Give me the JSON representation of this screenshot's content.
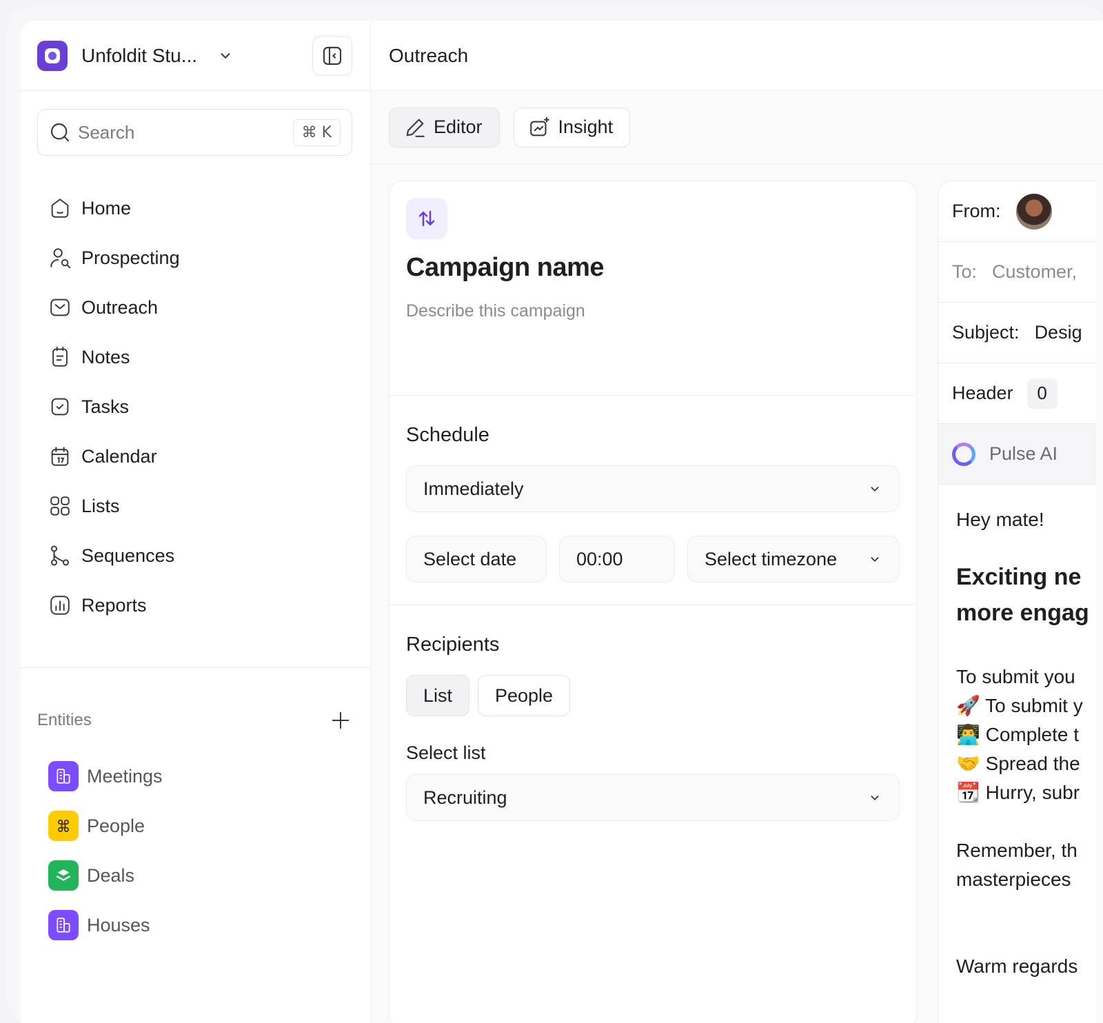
{
  "workspace": {
    "name": "Unfoldit Stu..."
  },
  "search": {
    "placeholder": "Search",
    "shortcut": "⌘ K"
  },
  "nav": [
    {
      "label": "Home",
      "icon": "home-icon"
    },
    {
      "label": "Prospecting",
      "icon": "user-search-icon"
    },
    {
      "label": "Outreach",
      "icon": "mail-icon"
    },
    {
      "label": "Notes",
      "icon": "notes-icon"
    },
    {
      "label": "Tasks",
      "icon": "task-check-icon"
    },
    {
      "label": "Calendar",
      "icon": "calendar-icon"
    },
    {
      "label": "Lists",
      "icon": "grid-icon"
    },
    {
      "label": "Sequences",
      "icon": "sequence-icon"
    },
    {
      "label": "Reports",
      "icon": "bar-chart-icon"
    }
  ],
  "entities": {
    "title": "Entities",
    "items": [
      {
        "label": "Meetings",
        "icon": "building-icon",
        "color": "#7c4dff"
      },
      {
        "label": "People",
        "icon": "people-icon",
        "color": "#ffcc00"
      },
      {
        "label": "Deals",
        "icon": "layers-icon",
        "color": "#22b45a"
      },
      {
        "label": "Houses",
        "icon": "building-icon",
        "color": "#7c4dff"
      }
    ]
  },
  "main": {
    "title": "Outreach",
    "tabs": [
      {
        "label": "Editor",
        "active": true
      },
      {
        "label": "Insight",
        "active": false
      }
    ]
  },
  "campaign": {
    "name": "Campaign name",
    "description_placeholder": "Describe this campaign",
    "schedule": {
      "title": "Schedule",
      "mode": "Immediately",
      "date_placeholder": "Select date",
      "time": "00:00",
      "timezone_placeholder": "Select timezone"
    },
    "recipients": {
      "title": "Recipients",
      "options": [
        "List",
        "People"
      ],
      "selected": "List",
      "select_label": "Select list",
      "list_value": "Recruiting"
    }
  },
  "email": {
    "from_label": "From:",
    "to_label": "To:",
    "to_value": "Customer,",
    "subject_label": "Subject:",
    "subject_value": "Desig",
    "header_label": "Header",
    "header_count": "0",
    "ai_label": "Pulse AI",
    "greeting": "Hey mate!",
    "headline_1": "Exciting ne",
    "headline_2": "more engag",
    "body_lines": [
      "To submit you",
      "🚀 To submit y",
      "👨‍💻 Complete t",
      "🤝 Spread the",
      "📆 Hurry, subr"
    ],
    "remember_1": "Remember, th",
    "remember_2": "masterpieces",
    "signoff": "Warm regards"
  },
  "colors": {
    "accent": "#6a3fd8",
    "border": "#ececf0",
    "muted_text": "#8a8a93"
  }
}
